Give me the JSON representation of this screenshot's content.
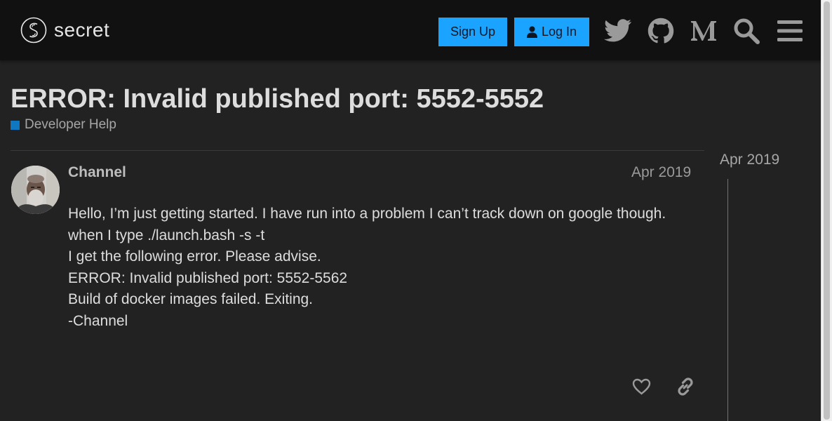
{
  "header": {
    "logo_text": "secret",
    "signup_label": "Sign Up",
    "login_label": "Log In",
    "icons": [
      "twitter-icon",
      "github-icon",
      "medium-icon",
      "search-icon",
      "hamburger-menu-icon"
    ],
    "accent_color": "#1aa3ff"
  },
  "topic": {
    "title": "ERROR: Invalid published port: 5552-5552",
    "category": "Developer Help",
    "category_color": "#0f78c0"
  },
  "post": {
    "username": "Channel",
    "date": "Apr 2019",
    "lines": [
      "Hello, I’m just getting started. I have run into a problem I can’t track down on google though.",
      "when I type ./launch.bash -s -t",
      "I get the following error. Please advise.",
      "ERROR: Invalid published port: 5552-5562",
      "Build of docker images failed. Exiting.",
      "-Channel"
    ],
    "actions": [
      "heart-icon",
      "link-icon"
    ]
  },
  "timeline": {
    "date": "Apr 2019"
  }
}
